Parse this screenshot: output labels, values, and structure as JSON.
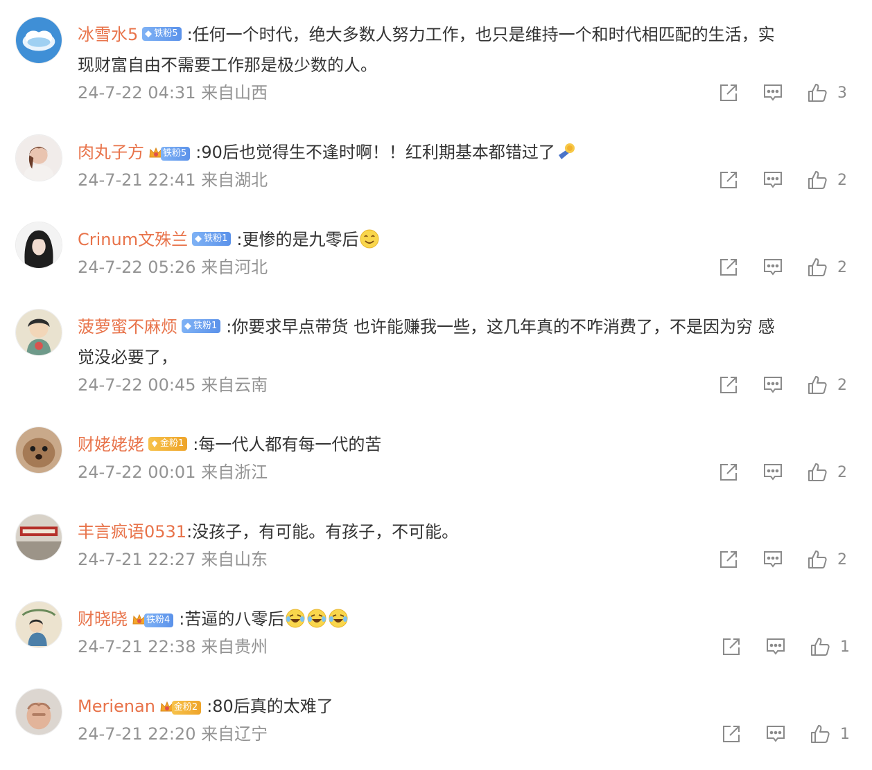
{
  "comments": [
    {
      "username": "冰雪水5",
      "badge": {
        "text": "铁粉5",
        "tier": "iron"
      },
      "text": ":任何一个时代，绝大多数人努力工作，也只是维持一个和时代相匹配的生活，实",
      "text2": "现财富自由不需要工作那是极少数的人。",
      "meta": "24-7-22 04:31 来自山西",
      "likes": "3"
    },
    {
      "username": "肉丸子方",
      "badge": {
        "text": "铁粉5",
        "tier": "iron"
      },
      "text": ":90后也觉得生不逢时啊！！红利期基本都错过了",
      "meta": "24-7-21 22:41 来自湖北",
      "likes": "2"
    },
    {
      "username": "Crinum文殊兰",
      "badge": {
        "text": "铁粉1",
        "tier": "iron"
      },
      "text": ":更惨的是九零后",
      "meta": "24-7-22 05:26 来自河北",
      "likes": "2"
    },
    {
      "username": "菠萝蜜不麻烦",
      "badge": {
        "text": "铁粉1",
        "tier": "iron"
      },
      "text": ":你要求早点带货 也许能赚我一些，这几年真的不咋消费了，不是因为穷 感",
      "text2": "觉没必要了，",
      "meta": "24-7-22 00:45 来自云南",
      "likes": "2"
    },
    {
      "username": "财姥姥姥",
      "badge": {
        "text": "金粉1",
        "tier": "gold"
      },
      "text": ":每一代人都有每一代的苦",
      "meta": "24-7-22 00:01 来自浙江",
      "likes": "2"
    },
    {
      "username": "丰言疯语0531",
      "text": ":没孩子，有可能。有孩子，不可能。",
      "meta": "24-7-21 22:27 来自山东",
      "likes": "2"
    },
    {
      "username": "财晓晓",
      "badge": {
        "text": "铁粉4",
        "tier": "iron"
      },
      "text": ":苦逼的八零后",
      "meta": "24-7-21 22:38 来自贵州",
      "likes": "1"
    },
    {
      "username": "Merienan",
      "badge": {
        "text": "金粉2",
        "tier": "gold"
      },
      "text": ":80后真的太难了",
      "meta": "24-7-21 22:20 来自辽宁",
      "likes": "1"
    }
  ],
  "icons": {
    "share": "share-icon",
    "comment": "comment-icon",
    "like": "like-icon",
    "badge_iron": "diamond-icon",
    "badge_gold": "medal-icon",
    "crown": "crown-icon"
  },
  "colors": {
    "username": "#e8734a",
    "text": "#333333",
    "meta": "#939393",
    "icon": "#8a8a8a",
    "iron_badge": "#6aa2f0",
    "gold_badge": "#f2b23a"
  }
}
